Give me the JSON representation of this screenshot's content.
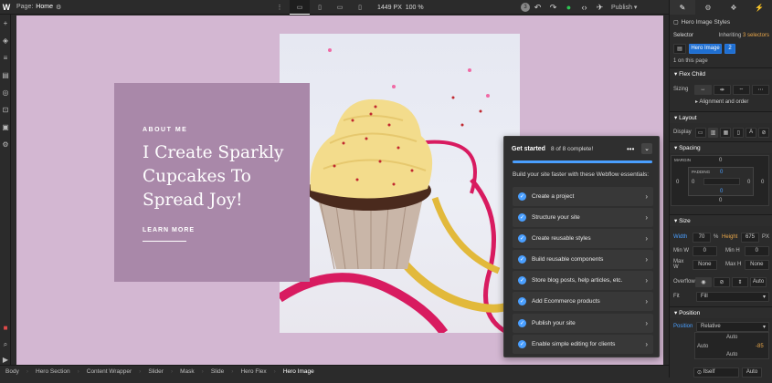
{
  "topbar": {
    "page_label": "Page:",
    "page_name": "Home",
    "width_px": "1449",
    "px_unit": "PX",
    "zoom": "100 %",
    "avatar": "3",
    "publish": "Publish"
  },
  "canvas": {
    "kicker": "ABOUT ME",
    "title": "I Create Sparkly Cupcakes To Spread Joy!",
    "link": "LEARN MORE"
  },
  "get_started": {
    "title": "Get started",
    "count": "8 of 8 complete!",
    "progress": 1.0,
    "subtitle": "Build your site faster with these Webflow essentials:",
    "items": [
      {
        "label": "Create a project"
      },
      {
        "label": "Structure your site"
      },
      {
        "label": "Create reusable styles"
      },
      {
        "label": "Build reusable components"
      },
      {
        "label": "Store blog posts, help articles, etc."
      },
      {
        "label": "Add Ecommerce products"
      },
      {
        "label": "Publish your site"
      },
      {
        "label": "Enable simple editing for clients"
      }
    ]
  },
  "breadcrumb": [
    "Body",
    "Hero Section",
    "Content Wrapper",
    "Slider",
    "Mask",
    "Slide",
    "Hero Flex",
    "Hero Image"
  ],
  "panel": {
    "styles_title": "Hero Image Styles",
    "selector_label": "Selector",
    "inheriting": "Inheriting",
    "selectors_count": "3 selectors",
    "class_tag": "Hero Image",
    "class_count": "2",
    "on_page": "1 on this page",
    "flex_child": "Flex Child",
    "sizing": "Sizing",
    "align_order": "Alignment and order",
    "layout": "Layout",
    "display": "Display",
    "spacing": "Spacing",
    "margin": "MARGIN",
    "padding": "PADDING",
    "zero": "0",
    "size": "Size",
    "width_label": "Width",
    "width_val": "70",
    "width_unit": "%",
    "height_label": "Height",
    "height_val": "675",
    "height_unit": "PX",
    "minw": "Min W",
    "minh": "Min H",
    "maxw": "Max W",
    "maxh": "Max H",
    "none": "None",
    "auto": "Auto",
    "overflow": "Overflow",
    "fit": "Fit",
    "fit_val": "Fill",
    "position": "Position",
    "position_label": "Position",
    "position_val": "Relative",
    "pos_auto": "Auto",
    "pos_neg": "-85",
    "itself": "Itself"
  },
  "colors": {
    "canvas_bg": "#d3b7d2",
    "card_bg": "#a988a9",
    "accent": "#4a9fff",
    "selector_blue": "#1f6fd1"
  }
}
